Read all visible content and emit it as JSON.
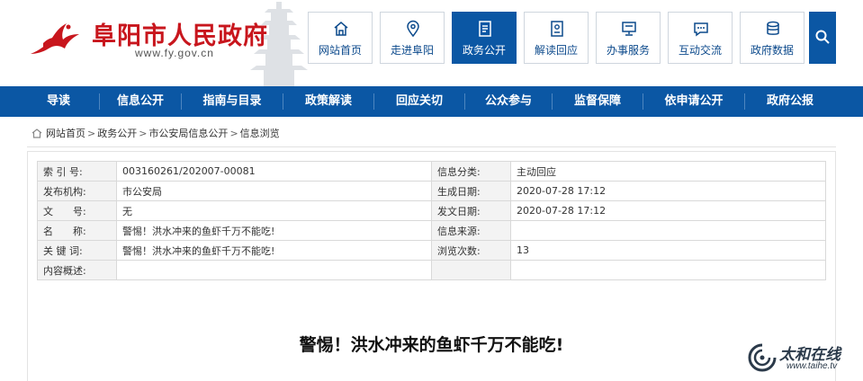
{
  "header": {
    "site_title": "阜阳市人民政府",
    "site_url": "www.fy.gov.cn",
    "top_nav": [
      {
        "label": "网站首页",
        "icon": "home-icon",
        "active": false
      },
      {
        "label": "走进阜阳",
        "icon": "location-pin-icon",
        "active": false
      },
      {
        "label": "政务公开",
        "icon": "document-list-icon",
        "active": true
      },
      {
        "label": "解读回应",
        "icon": "id-card-icon",
        "active": false
      },
      {
        "label": "办事服务",
        "icon": "monitor-icon",
        "active": false
      },
      {
        "label": "互动交流",
        "icon": "chat-bubble-icon",
        "active": false
      },
      {
        "label": "政府数据",
        "icon": "database-icon",
        "active": false
      }
    ],
    "search_icon": "search-icon"
  },
  "main_nav": [
    "导读",
    "信息公开",
    "指南与目录",
    "政策解读",
    "回应关切",
    "公众参与",
    "监督保障",
    "依申请公开",
    "政府公报"
  ],
  "breadcrumb": [
    "网站首页",
    "政务公开",
    "市公安局信息公开",
    "信息浏览"
  ],
  "meta_table": [
    {
      "label": "索 引 号:",
      "value": "003160261/202007-00081",
      "label2": "信息分类:",
      "value2": "主动回应"
    },
    {
      "label": "发布机构:",
      "value": "市公安局",
      "label2": "生成日期:",
      "value2": "2020-07-28 17:12"
    },
    {
      "label": "文　　号:",
      "value": "无",
      "label2": "发文日期:",
      "value2": "2020-07-28 17:12"
    },
    {
      "label": "名　　称:",
      "value": "警惕！洪水冲来的鱼虾千万不能吃!",
      "label2": "信息来源:",
      "value2": ""
    },
    {
      "label": "关 键 词:",
      "value": "警惕！洪水冲来的鱼虾千万不能吃!",
      "label2": "浏览次数:",
      "value2": "13"
    },
    {
      "label": "内容概述:",
      "value": "",
      "label2": "",
      "value2": ""
    }
  ],
  "article": {
    "title": "警惕！洪水冲来的鱼虾千万不能吃!"
  },
  "watermark": {
    "text": "太和在线",
    "url": "www.taihe.tv"
  },
  "colors": {
    "brand_red": "#c8161d",
    "nav_blue": "#0b57a4",
    "text_blue": "#0c4a8c"
  }
}
